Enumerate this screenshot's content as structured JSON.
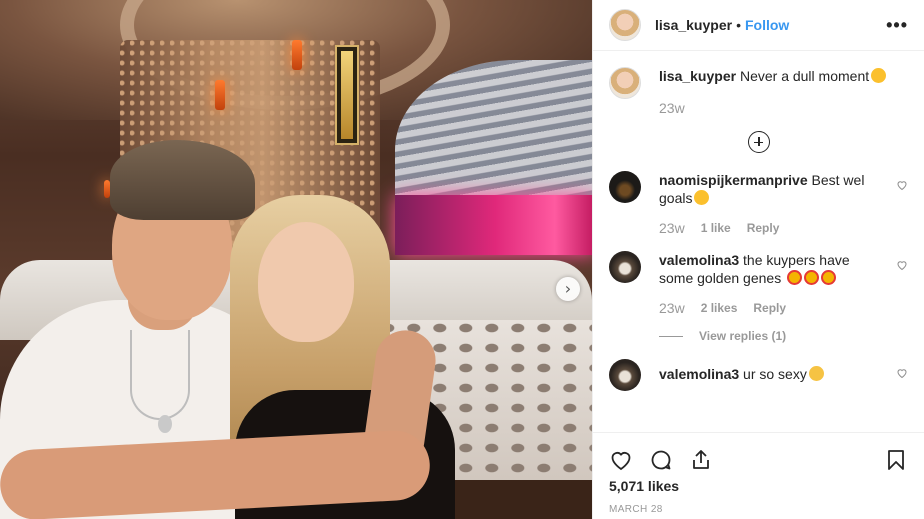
{
  "post": {
    "username": "lisa_kuyper",
    "dot": "•",
    "follow_label": "Follow",
    "more_icon": "more-options-icon",
    "more_glyph": "•••",
    "next_arrow_glyph": "›",
    "caption": "Never a dull moment",
    "caption_emoji": "silly-face",
    "caption_time": "23w",
    "load_more_icon": "plus-circle-icon"
  },
  "comments": [
    {
      "username": "naomispijkermanprive",
      "text": "Best wel goals",
      "emoji": [
        "kiss-face"
      ],
      "time": "23w",
      "likes": "1 like",
      "reply_label": "Reply",
      "view_replies": ""
    },
    {
      "username": "valemolina3",
      "text": "the kuypers have some golden genes",
      "emoji": [
        "heart-eyes",
        "heart-eyes",
        "heart-eyes"
      ],
      "time": "23w",
      "likes": "2 likes",
      "reply_label": "Reply",
      "view_replies": "View replies (1)"
    },
    {
      "username": "valemolina3",
      "text": "ur so sexy",
      "emoji": [
        "crying-face"
      ]
    }
  ],
  "actions": {
    "like_icon": "heart-icon",
    "comment_icon": "comment-icon",
    "share_icon": "share-icon",
    "save_icon": "bookmark-icon"
  },
  "likes_count": "5,071 likes",
  "date": "MARCH 28",
  "colors": {
    "link": "#3897f0",
    "text": "#262626",
    "muted": "#999999",
    "border": "#efefef"
  }
}
